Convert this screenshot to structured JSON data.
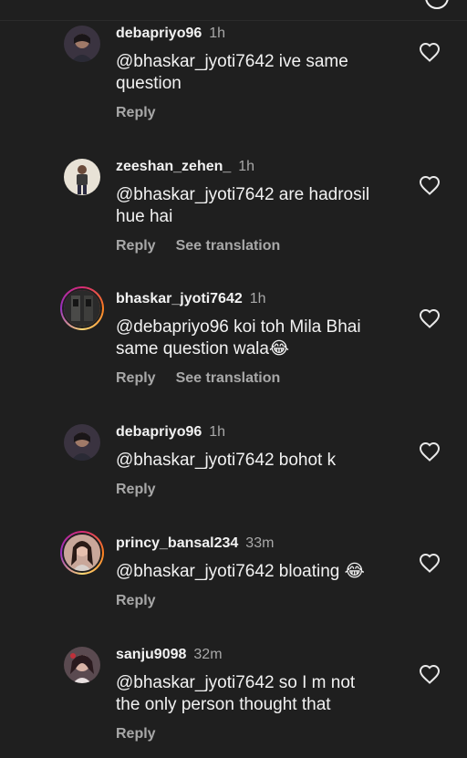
{
  "comments": [
    {
      "username": "debapriyo96",
      "time": "1h",
      "text_lines": [
        "@bhaskar_jyoti7642 ive same",
        "question"
      ],
      "reply_label": "Reply",
      "see_translation": ""
    },
    {
      "username": "zeeshan_zehen_",
      "time": "1h",
      "text_lines": [
        "@bhaskar_jyoti7642 are hadrosil",
        "hue hai"
      ],
      "reply_label": "Reply",
      "see_translation": "See translation"
    },
    {
      "username": "bhaskar_jyoti7642",
      "time": "1h",
      "text_lines": [
        "@debapriyo96 koi toh Mila Bhai",
        "same question wala😂"
      ],
      "reply_label": "Reply",
      "see_translation": "See translation"
    },
    {
      "username": "debapriyo96",
      "time": "1h",
      "text_lines": [
        "@bhaskar_jyoti7642  bohot k"
      ],
      "reply_label": "Reply",
      "see_translation": ""
    },
    {
      "username": "princy_bansal234",
      "time": "33m",
      "text_lines": [
        "@bhaskar_jyoti7642 bloating 😂"
      ],
      "reply_label": "Reply",
      "see_translation": ""
    },
    {
      "username": "sanju9098",
      "time": "32m",
      "text_lines": [
        "@bhaskar_jyoti7642  so I m not",
        "the only person thought that"
      ],
      "reply_label": "Reply",
      "see_translation": ""
    }
  ],
  "icons": {
    "like": "heart-outline-icon",
    "top": "circle-icon"
  },
  "colors": {
    "background": "#1f1f1f",
    "text": "#f2f2f2",
    "secondary": "#a8a8a8",
    "story_ring": "#d62976"
  }
}
